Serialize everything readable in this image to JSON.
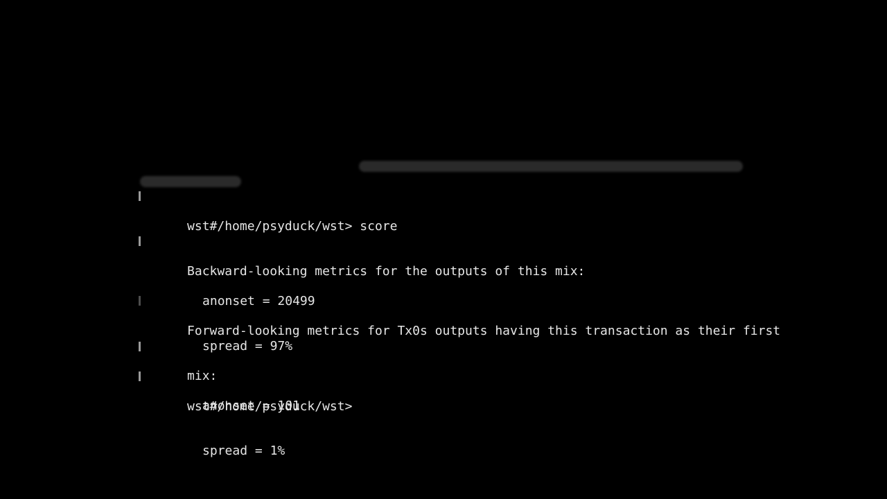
{
  "terminal": {
    "prompt": "wst#/home/psyduck/wst>",
    "command": "score",
    "backward": {
      "heading": "Backward-looking metrics for the outputs of this mix:",
      "anonset": "anonset = 20499",
      "spread": "spread = 97%"
    },
    "forward": {
      "heading_line1": "Forward-looking metrics for Tx0s outputs having this transaction as their first",
      "heading_line2": "mix:",
      "anonset": "anonset = 101",
      "spread": "spread = 1%"
    }
  },
  "colors": {
    "background": "#000000",
    "text": "#e6e6e6"
  }
}
